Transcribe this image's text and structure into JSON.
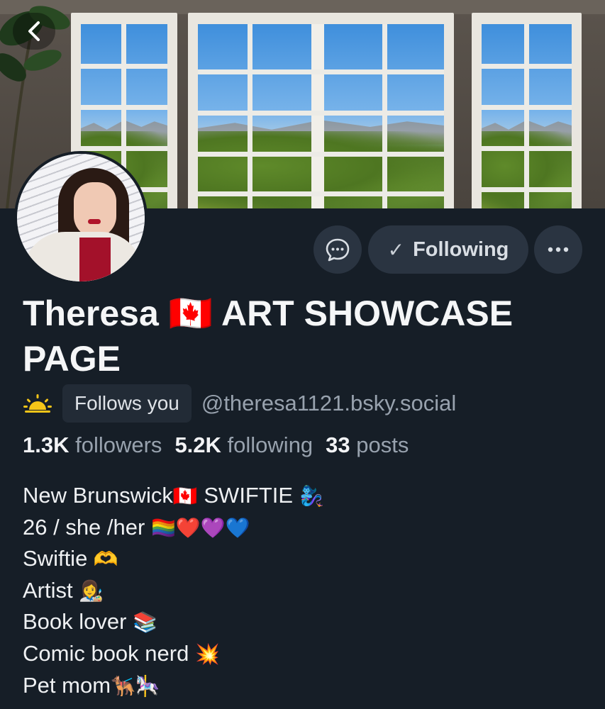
{
  "nav": {
    "back_icon": "chevron-left-icon"
  },
  "actions": {
    "message_icon": "chat-bubble-icon",
    "following_check": "✓",
    "following_label": "Following",
    "more_icon": "ellipsis-icon"
  },
  "profile": {
    "display_name": "Theresa 🇨🇦 ART SHOWCASE PAGE",
    "status_icon": "🌅",
    "follows_you_badge": "Follows you",
    "handle": "@theresa1121.bsky.social"
  },
  "stats": {
    "followers_count": "1.3K",
    "followers_label": "followers",
    "following_count": "5.2K",
    "following_label": "following",
    "posts_count": "33",
    "posts_label": "posts"
  },
  "bio": [
    {
      "text": "New Brunswick",
      "emoji": "🇨🇦",
      "text2": " SWIFTIE",
      "emoji2": " 🧞‍♀️"
    },
    {
      "text": "26 / she /her ",
      "emoji": "🏳️‍🌈❤️💜💙",
      "text2": "",
      "emoji2": ""
    },
    {
      "text": "Swiftie ",
      "emoji": "🫶",
      "text2": "",
      "emoji2": ""
    },
    {
      "text": "Artist ",
      "emoji": "👩‍🎨",
      "text2": "",
      "emoji2": ""
    },
    {
      "text": "Book lover ",
      "emoji": "📚",
      "text2": "",
      "emoji2": ""
    },
    {
      "text": "Comic book nerd ",
      "emoji": "💥",
      "text2": "",
      "emoji2": ""
    },
    {
      "text": "Pet mom",
      "emoji": "🐕‍🦺🎠",
      "text2": "",
      "emoji2": ""
    }
  ],
  "colors": {
    "background": "#161e27",
    "button": "#2a3441",
    "muted_text": "#98a2ae"
  }
}
